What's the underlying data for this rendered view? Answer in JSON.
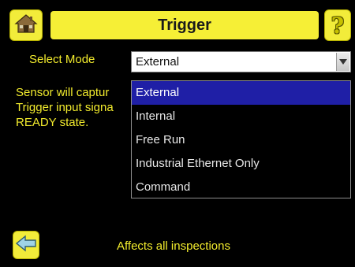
{
  "header": {
    "title": "Trigger",
    "home_icon": "home-icon",
    "help_label": "?"
  },
  "mode": {
    "label": "Select Mode",
    "selected_value": "External"
  },
  "description": {
    "lines": [
      "Sensor will captur",
      "Trigger input signa",
      "READY state."
    ]
  },
  "dropdown": {
    "options": [
      "External",
      "Internal",
      "Free Run",
      "Industrial Ethernet Only",
      "Command"
    ],
    "highlighted": "External"
  },
  "footer": {
    "note": "Affects all inspections",
    "back_icon": "back-arrow-icon"
  },
  "colors": {
    "accent_yellow": "#f6ef36",
    "label_yellow": "#f3ec2d",
    "highlight_blue": "#1f1fa6",
    "background": "#000000"
  }
}
